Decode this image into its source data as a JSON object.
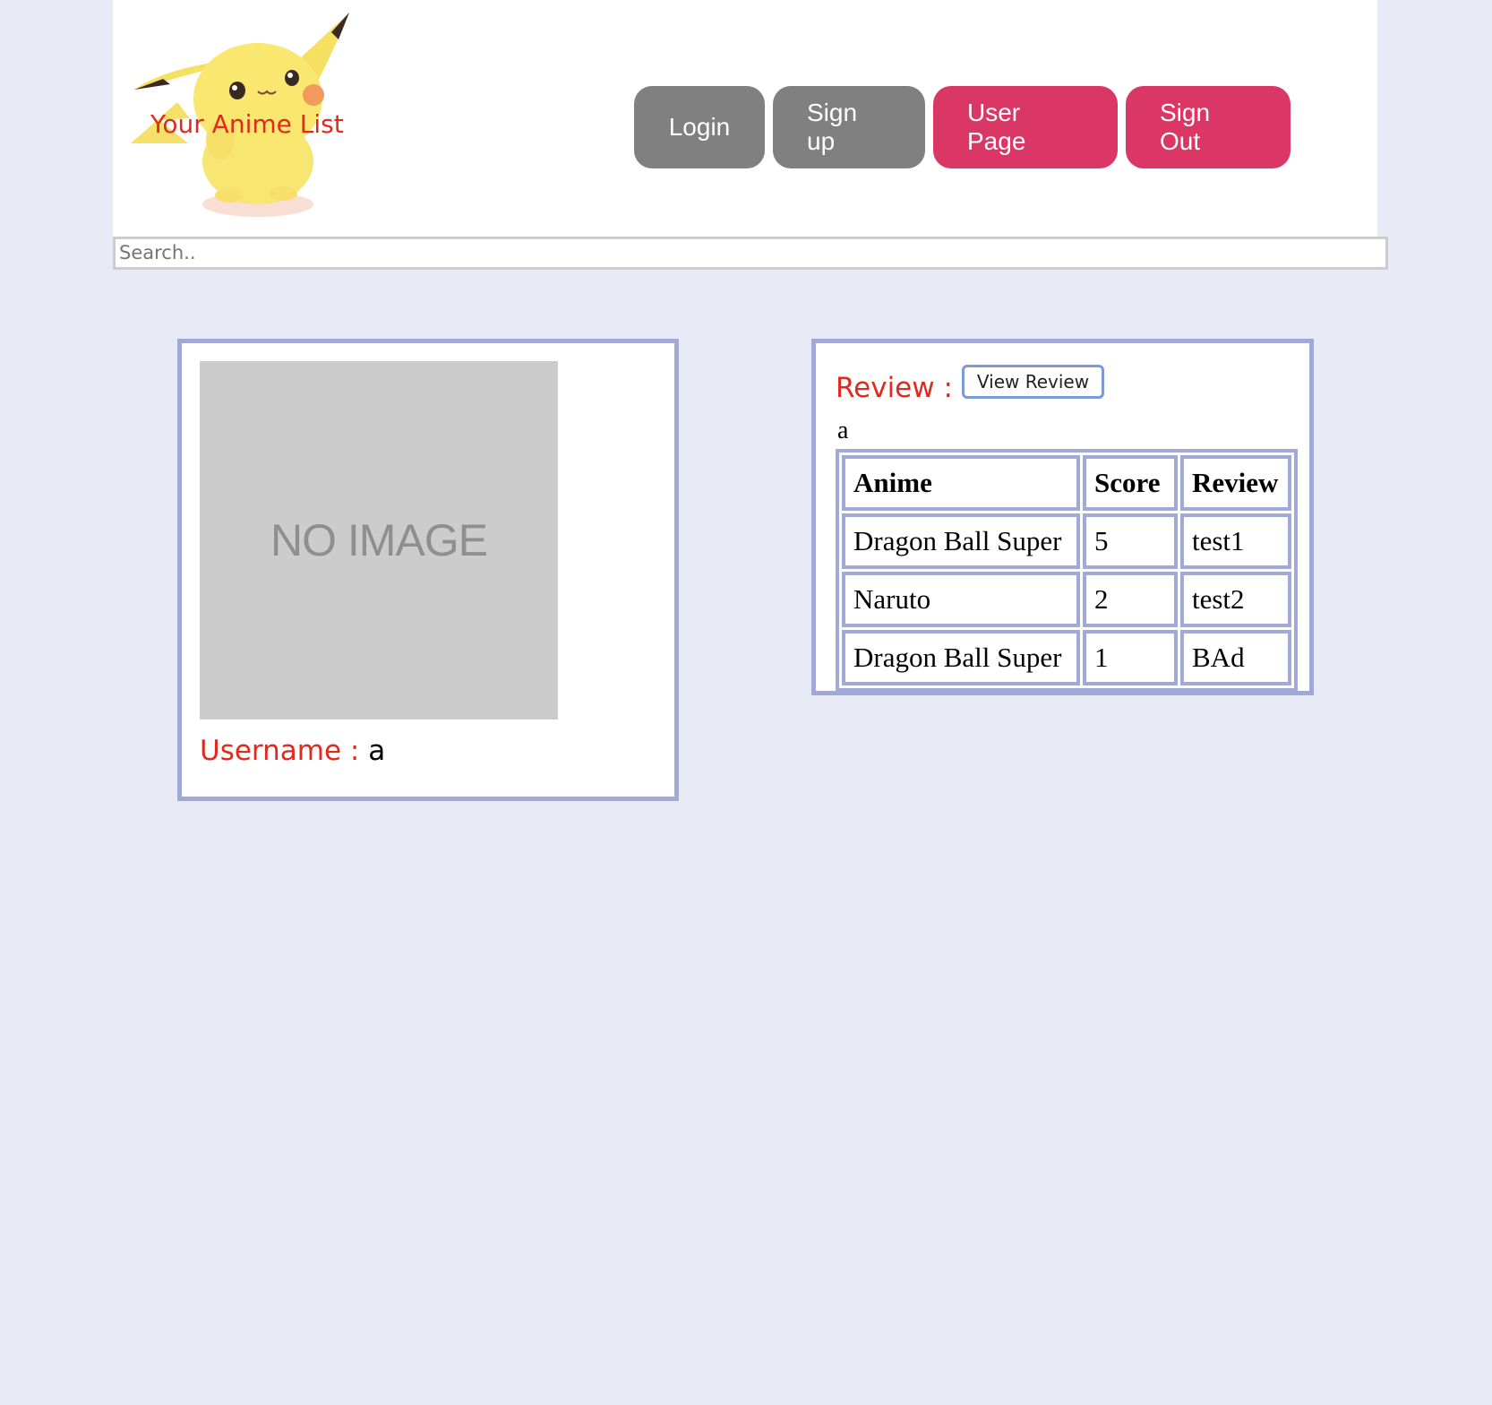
{
  "header": {
    "logo_text": "Your Anime List",
    "nav": {
      "login": "Login",
      "signup": "Sign up",
      "user_page": "User Page",
      "sign_out": "Sign Out"
    }
  },
  "search": {
    "placeholder": "Search.."
  },
  "profile": {
    "image_placeholder": "NO IMAGE",
    "username_label": "Username :",
    "username_value": "a"
  },
  "review": {
    "label": "Review :",
    "view_button": "View Review",
    "user": "a",
    "columns": [
      "Anime",
      "Score",
      "Review"
    ],
    "rows": [
      [
        "Dragon Ball Super",
        "5",
        "test1"
      ],
      [
        "Naruto",
        "2",
        "test2"
      ],
      [
        "Dragon Ball Super",
        "1",
        "BAd"
      ]
    ]
  },
  "colors": {
    "page_bg": "#e8eaf5",
    "accent_red": "#e02a1d",
    "button_gray": "#808080",
    "button_pink": "#db3766",
    "card_border": "#a1aad6"
  }
}
